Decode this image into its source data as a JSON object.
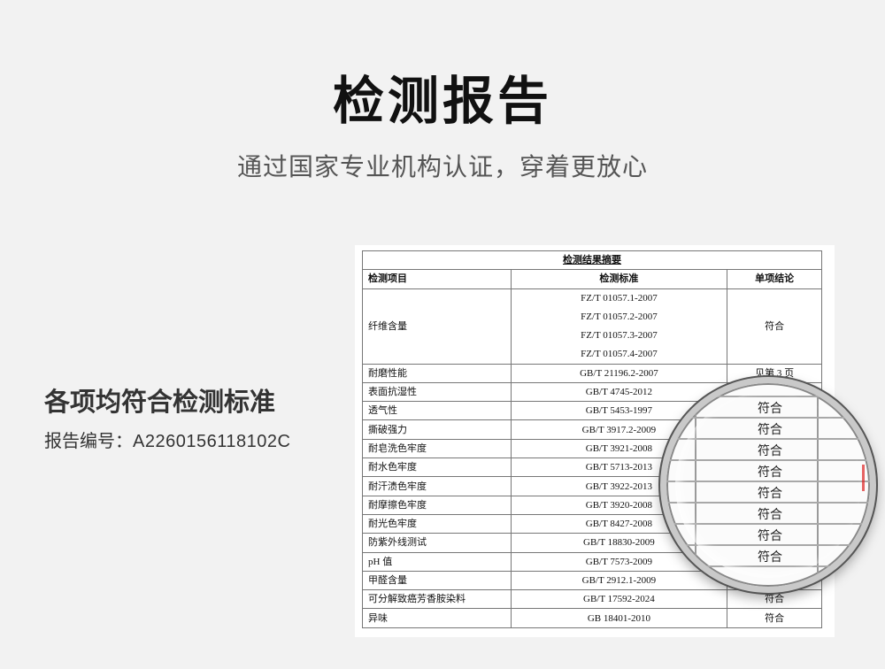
{
  "header": {
    "title": "检测报告",
    "subtitle": "通过国家专业机构认证，穿着更放心"
  },
  "left": {
    "heading": "各项均符合检测标准",
    "report_label": "报告编号：",
    "report_number": "A2260156118102C"
  },
  "table": {
    "caption": "检测结果摘要",
    "headers": [
      "检测项目",
      "检测标准",
      "单项结论"
    ],
    "first_row": {
      "item": "纤维含量",
      "standards": [
        "FZ/T 01057.1-2007",
        "FZ/T 01057.2-2007",
        "FZ/T 01057.3-2007",
        "FZ/T 01057.4-2007"
      ],
      "result": "符合"
    },
    "rows": [
      {
        "item": "耐磨性能",
        "standard": "GB/T 21196.2-2007",
        "result": "见第 3 页"
      },
      {
        "item": "表面抗湿性",
        "standard": "GB/T 4745-2012",
        "result": ""
      },
      {
        "item": "透气性",
        "standard": "GB/T 5453-1997",
        "result": ""
      },
      {
        "item": "撕破强力",
        "standard": "GB/T 3917.2-2009",
        "result": ""
      },
      {
        "item": "耐皂洗色牢度",
        "standard": "GB/T 3921-2008",
        "result": ""
      },
      {
        "item": "耐水色牢度",
        "standard": "GB/T 5713-2013",
        "result": ""
      },
      {
        "item": "耐汗渍色牢度",
        "standard": "GB/T 3922-2013",
        "result": ""
      },
      {
        "item": "耐摩擦色牢度",
        "standard": "GB/T 3920-2008",
        "result": ""
      },
      {
        "item": "耐光色牢度",
        "standard": "GB/T 8427-2008",
        "result": ""
      },
      {
        "item": "防紫外线测试",
        "standard": "GB/T 18830-2009",
        "result": ""
      },
      {
        "item": "pH 值",
        "standard": "GB/T 7573-2009",
        "result": ""
      },
      {
        "item": "甲醛含量",
        "standard": "GB/T 2912.1-2009",
        "result": ""
      },
      {
        "item": "可分解致癌芳香胺染料",
        "standard": "GB/T 17592-2024",
        "result": "符合"
      },
      {
        "item": "异味",
        "standard": "GB 18401-2010",
        "result": "符合"
      }
    ]
  },
  "magnifier": {
    "results": [
      "符合",
      "符合",
      "符合",
      "符合",
      "符合",
      "符合",
      "符合",
      "符合"
    ]
  }
}
